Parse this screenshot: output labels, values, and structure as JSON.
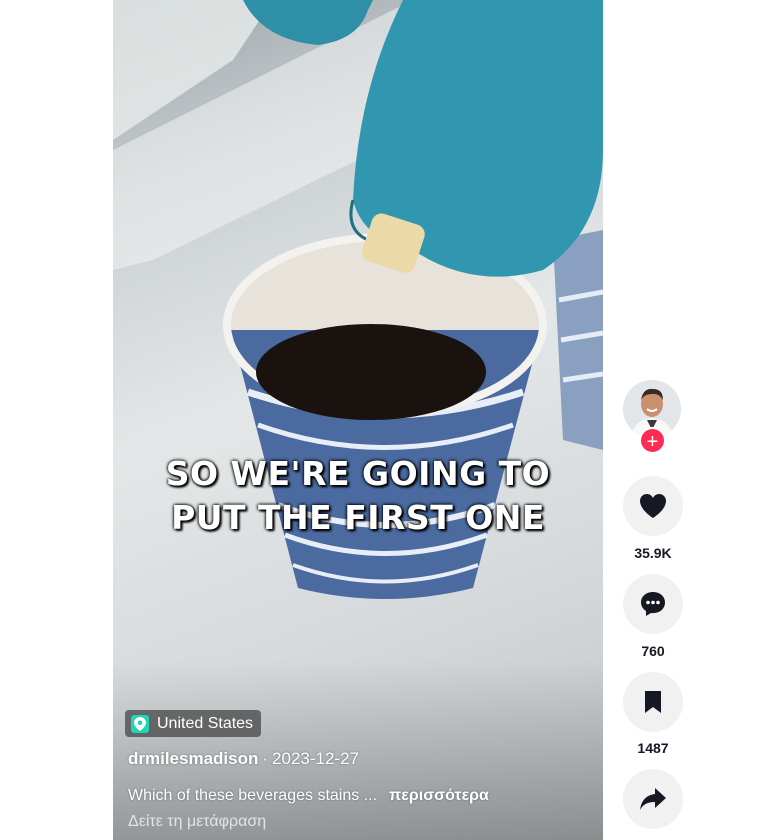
{
  "video": {
    "caption_line1": "SO WE'RE GOING TO",
    "caption_line2": "PUT THE FIRST ONE"
  },
  "location": {
    "icon": "location-pin-icon",
    "label": "United States"
  },
  "post": {
    "author": "drmilesmadison",
    "separator": "·",
    "date": "2023-12-27",
    "description": "Which of these beverages stains ...",
    "more_label": "περισσότερα",
    "translate_label": "Δείτε τη μετάφραση"
  },
  "actions": {
    "follow_label": "+",
    "likes": "35.9K",
    "comments": "760",
    "saves": "1487"
  },
  "colors": {
    "follow": "#fe2c55",
    "location_icon": "#20d5b7",
    "action_bg": "#f1f1f2"
  }
}
